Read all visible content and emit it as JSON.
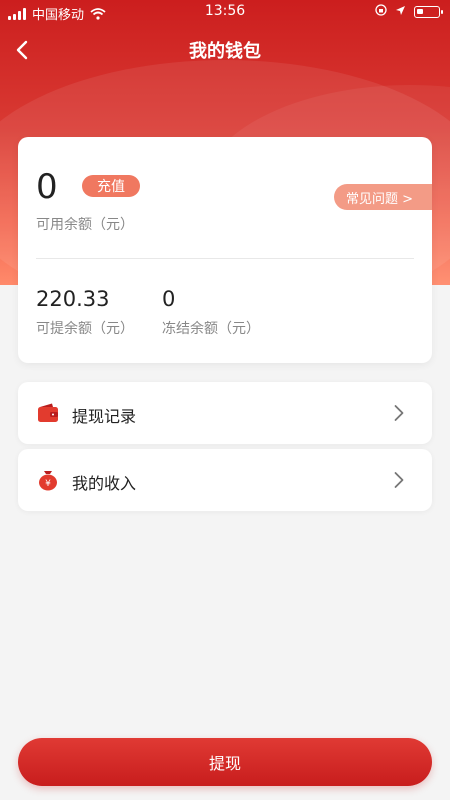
{
  "status_bar": {
    "carrier": "中国移动",
    "time": "13:56"
  },
  "header": {
    "title": "我的钱包"
  },
  "balance_card": {
    "available_amount": "0",
    "recharge_label": "充值",
    "available_label": "可用余额（元）",
    "faq_label": "常见问题 >",
    "withdrawable_amount": "220.33",
    "withdrawable_label": "可提余额（元）",
    "frozen_amount": "0",
    "frozen_label": "冻结余额（元）"
  },
  "menu": [
    {
      "label": "提现记录",
      "icon": "wallet-icon"
    },
    {
      "label": "我的收入",
      "icon": "income-bag-icon"
    }
  ],
  "footer": {
    "withdraw_label": "提现"
  },
  "colors": {
    "brand_red": "#cc1e1e",
    "accent_orange": "#f07860",
    "faq_bg": "#f39b86"
  }
}
